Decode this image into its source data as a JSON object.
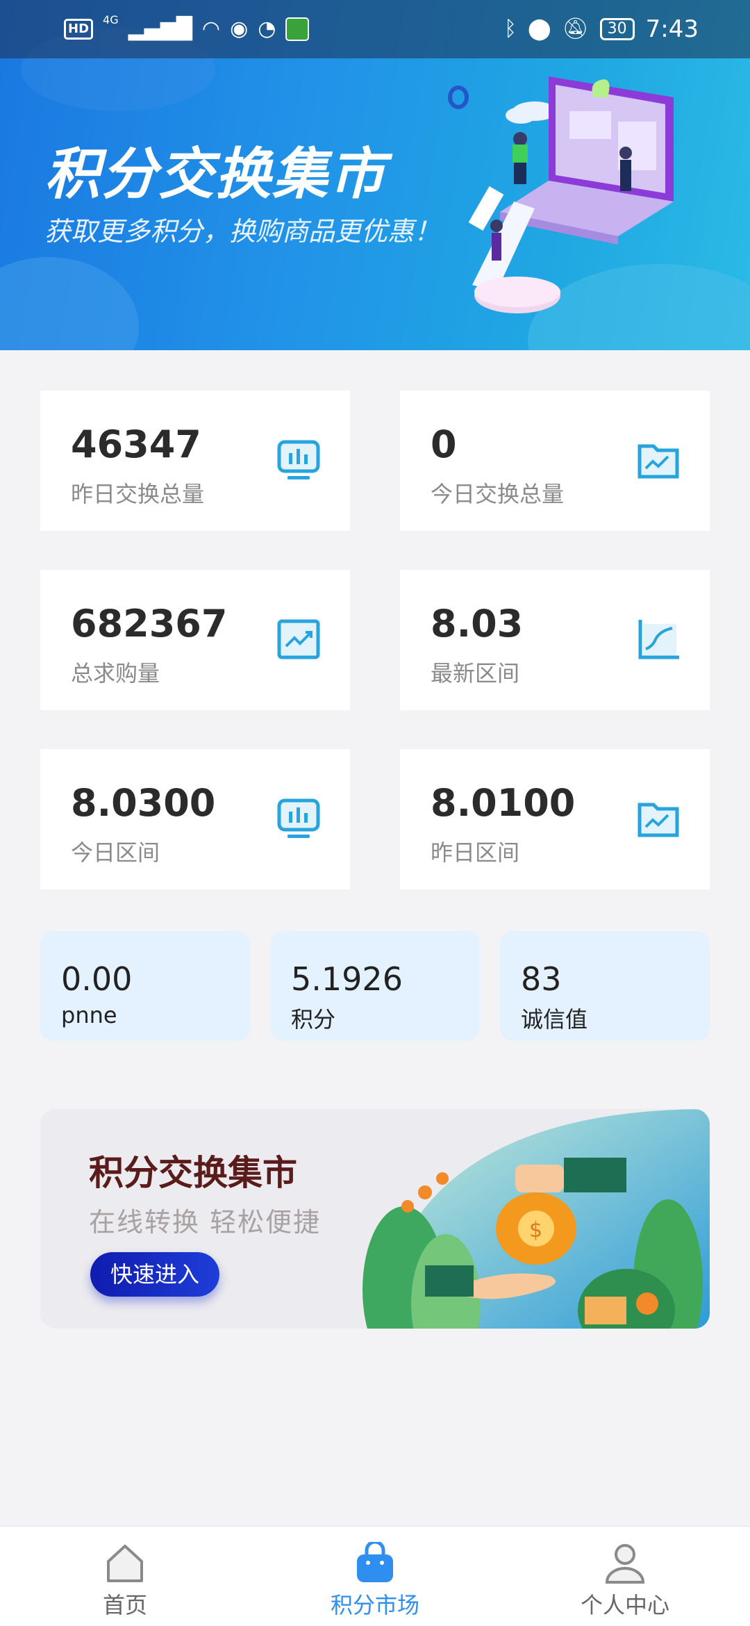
{
  "status_bar": {
    "hd": "HD",
    "network": "4G",
    "battery": "30",
    "time": "7:43"
  },
  "hero": {
    "title": "积分交换集市",
    "subtitle": "获取更多积分，换购商品更优惠！"
  },
  "stats": [
    {
      "value": "46347",
      "label": "昨日交换总量",
      "icon": "monitor-chart-icon"
    },
    {
      "value": "0",
      "label": "今日交换总量",
      "icon": "folder-chart-icon"
    },
    {
      "value": "682367",
      "label": "总求购量",
      "icon": "trend-up-icon"
    },
    {
      "value": "8.03",
      "label": "最新区间",
      "icon": "line-chart-icon"
    },
    {
      "value": "8.0300",
      "label": "今日区间",
      "icon": "monitor-chart-icon"
    },
    {
      "value": "8.0100",
      "label": "昨日区间",
      "icon": "folder-chart-icon"
    }
  ],
  "tiles": [
    {
      "value": "0.00",
      "label": "pnne"
    },
    {
      "value": "5.1926",
      "label": "积分"
    },
    {
      "value": "83",
      "label": "诚信值"
    }
  ],
  "promo": {
    "title": "积分交换集市",
    "subtitle": "在线转换  轻松便捷",
    "button": "快速进入"
  },
  "nav": {
    "items": [
      {
        "label": "首页",
        "icon": "home-icon",
        "active": false
      },
      {
        "label": "积分市场",
        "icon": "shopping-bag-icon",
        "active": true
      },
      {
        "label": "个人中心",
        "icon": "user-icon",
        "active": false
      }
    ],
    "active_color": "#2f8ff0",
    "inactive_color": "#666666"
  },
  "colors": {
    "accent": "#2f8ff0",
    "icon_blue": "#27a4dd",
    "tile_bg": "#e3f2fe"
  }
}
